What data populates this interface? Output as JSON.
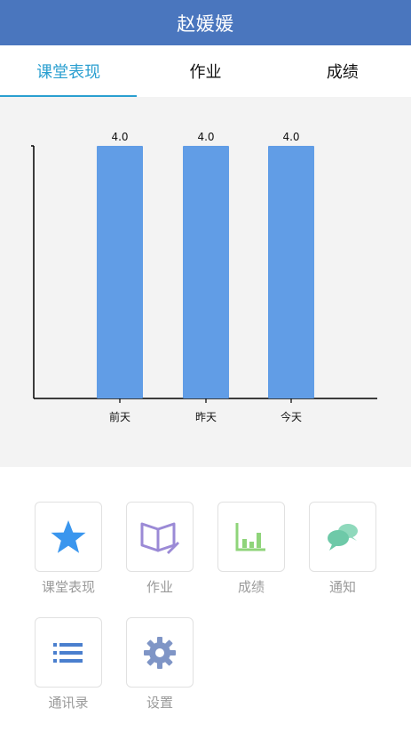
{
  "header": {
    "title": "赵媛媛"
  },
  "tabs": [
    {
      "label": "课堂表现",
      "active": true
    },
    {
      "label": "作业",
      "active": false
    },
    {
      "label": "成绩",
      "active": false
    }
  ],
  "chart_data": {
    "type": "bar",
    "categories": [
      "前天",
      "昨天",
      "今天"
    ],
    "values": [
      4.0,
      4.0,
      4.0
    ],
    "value_labels": [
      "4.0",
      "4.0",
      "4.0"
    ],
    "title": "",
    "xlabel": "",
    "ylabel": "",
    "ylim": [
      0,
      4.0
    ],
    "grid": false,
    "bar_color": "#619de6"
  },
  "menu": [
    {
      "label": "课堂表现",
      "icon": "star-icon",
      "color": "#3a96ee"
    },
    {
      "label": "作业",
      "icon": "book-icon",
      "color": "#9b8ad6"
    },
    {
      "label": "成绩",
      "icon": "bar-chart-icon",
      "color": "#8fd47a"
    },
    {
      "label": "通知",
      "icon": "chat-bubbles-icon",
      "color": "#6ec9a8"
    },
    {
      "label": "通讯录",
      "icon": "list-icon",
      "color": "#4a7fce"
    },
    {
      "label": "设置",
      "icon": "gear-icon",
      "color": "#7f95c6"
    }
  ]
}
